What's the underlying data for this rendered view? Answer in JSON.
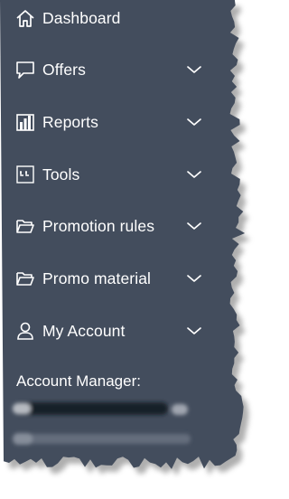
{
  "sidebar": {
    "background": "#434d5d",
    "items": [
      {
        "label": "Dashboard",
        "icon": "home-icon",
        "has_chevron": false
      },
      {
        "label": "Offers",
        "icon": "speech-bubble-icon",
        "has_chevron": true
      },
      {
        "label": "Reports",
        "icon": "bar-chart-icon",
        "has_chevron": true
      },
      {
        "label": "Tools",
        "icon": "tools-grid-icon",
        "has_chevron": true
      },
      {
        "label": "Promotion rules",
        "icon": "folder-icon",
        "has_chevron": true
      },
      {
        "label": "Promo material",
        "icon": "folder-icon",
        "has_chevron": true
      },
      {
        "label": "My Account",
        "icon": "user-icon",
        "has_chevron": true
      }
    ],
    "account_manager": {
      "label": "Account Manager:"
    }
  }
}
